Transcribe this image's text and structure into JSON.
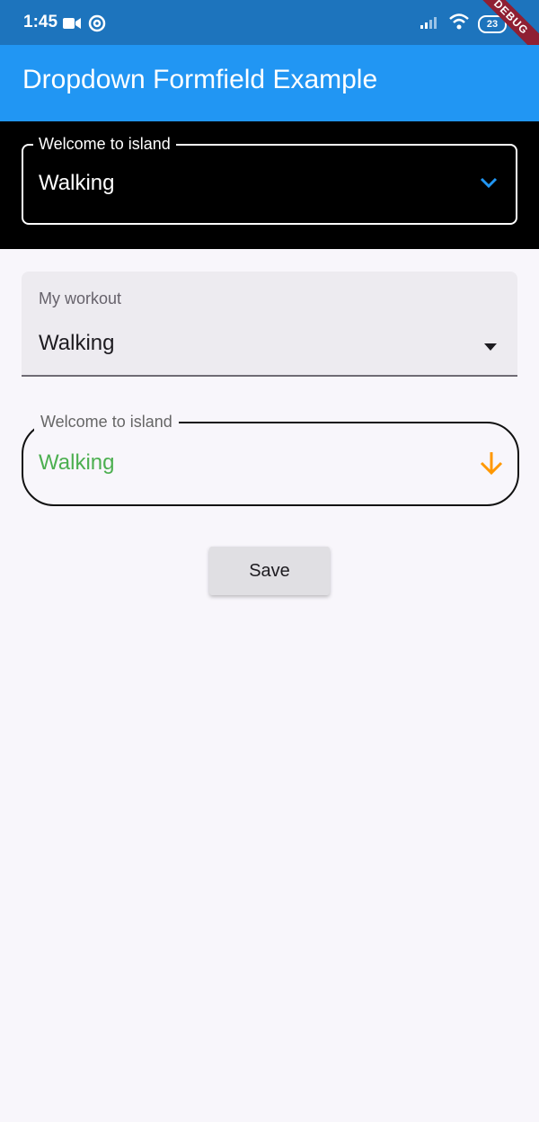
{
  "status_bar": {
    "time": "1:45",
    "battery_level": "23",
    "debug_banner": "DEBUG",
    "icons": [
      "video-camera-icon",
      "at-sign-icon",
      "cellular-signal-icon",
      "wifi-icon",
      "battery-icon"
    ]
  },
  "app_bar": {
    "title": "Dropdown Formfield Example",
    "color": "#2196f3"
  },
  "form": {
    "outlined_dropdown": {
      "label": "Welcome to island",
      "value": "Walking",
      "icon": "chevron-down-icon",
      "icon_color": "#2196f3",
      "background": "#000000"
    },
    "filled_dropdown": {
      "label": "My workout",
      "value": "Walking",
      "icon": "arrow-drop-down-icon"
    },
    "rounded_dropdown": {
      "label": "Welcome to island",
      "value": "Walking",
      "value_color": "#4caf50",
      "icon": "arrow-down-icon",
      "icon_color": "#ff9800"
    },
    "save_label": "Save"
  }
}
